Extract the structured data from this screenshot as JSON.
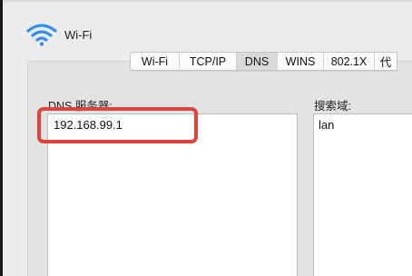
{
  "header": {
    "title": "Wi-Fi",
    "icon": "wifi-icon"
  },
  "tabs": [
    {
      "label": "Wi-Fi",
      "active": false
    },
    {
      "label": "TCP/IP",
      "active": false
    },
    {
      "label": "DNS",
      "active": true
    },
    {
      "label": "WINS",
      "active": false
    },
    {
      "label": "802.1X",
      "active": false
    },
    {
      "label": "代",
      "active": false
    }
  ],
  "dns": {
    "label": "DNS 服务器:",
    "servers": [
      "192.168.99.1"
    ]
  },
  "search": {
    "label": "搜索域:",
    "domains": [
      "lan"
    ]
  },
  "colors": {
    "highlight": "#e0433d",
    "wifi_icon": "#2f8ff2"
  }
}
